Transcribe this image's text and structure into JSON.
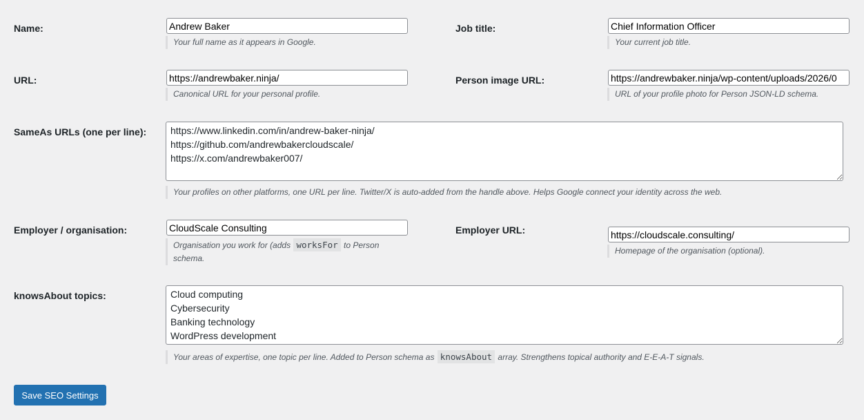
{
  "fields": {
    "name": {
      "label": "Name:",
      "value": "Andrew Baker",
      "description": "Your full name as it appears in Google."
    },
    "job_title": {
      "label": "Job title:",
      "value": "Chief Information Officer",
      "description": "Your current job title."
    },
    "url": {
      "label": "URL:",
      "value": "https://andrewbaker.ninja/",
      "description": "Canonical URL for your personal profile."
    },
    "person_image_url": {
      "label": "Person image URL:",
      "value": "https://andrewbaker.ninja/wp-content/uploads/2026/0",
      "description": "URL of your profile photo for Person JSON-LD schema."
    },
    "same_as": {
      "label": "SameAs URLs (one per line):",
      "value": "https://www.linkedin.com/in/andrew-baker-ninja/\nhttps://github.com/andrewbakercloudscale/\nhttps://x.com/andrewbaker007/",
      "description": "Your profiles on other platforms, one URL per line. Twitter/X is auto-added from the handle above. Helps Google connect your identity across the web."
    },
    "employer": {
      "label": "Employer / organisation:",
      "value": "CloudScale Consulting",
      "desc_before": "Organisation you work for (adds",
      "desc_code": "worksFor",
      "desc_after": "to Person schema."
    },
    "employer_url": {
      "label": "Employer URL:",
      "value": "https://cloudscale.consulting/",
      "description": "Homepage of the organisation (optional)."
    },
    "knows_about": {
      "label": "knowsAbout topics:",
      "value": "Cloud computing\nCybersecurity\nBanking technology\nWordPress development",
      "desc_before": "Your areas of expertise, one topic per line. Added to Person schema as",
      "desc_code": "knowsAbout",
      "desc_after": "array. Strengthens topical authority and E-E-A-T signals."
    }
  },
  "save_button": {
    "label": "Save SEO Settings"
  },
  "colors": {
    "background": "#f0f0f1",
    "primary_button": "#2271b1",
    "input_border": "#8c8f94"
  }
}
